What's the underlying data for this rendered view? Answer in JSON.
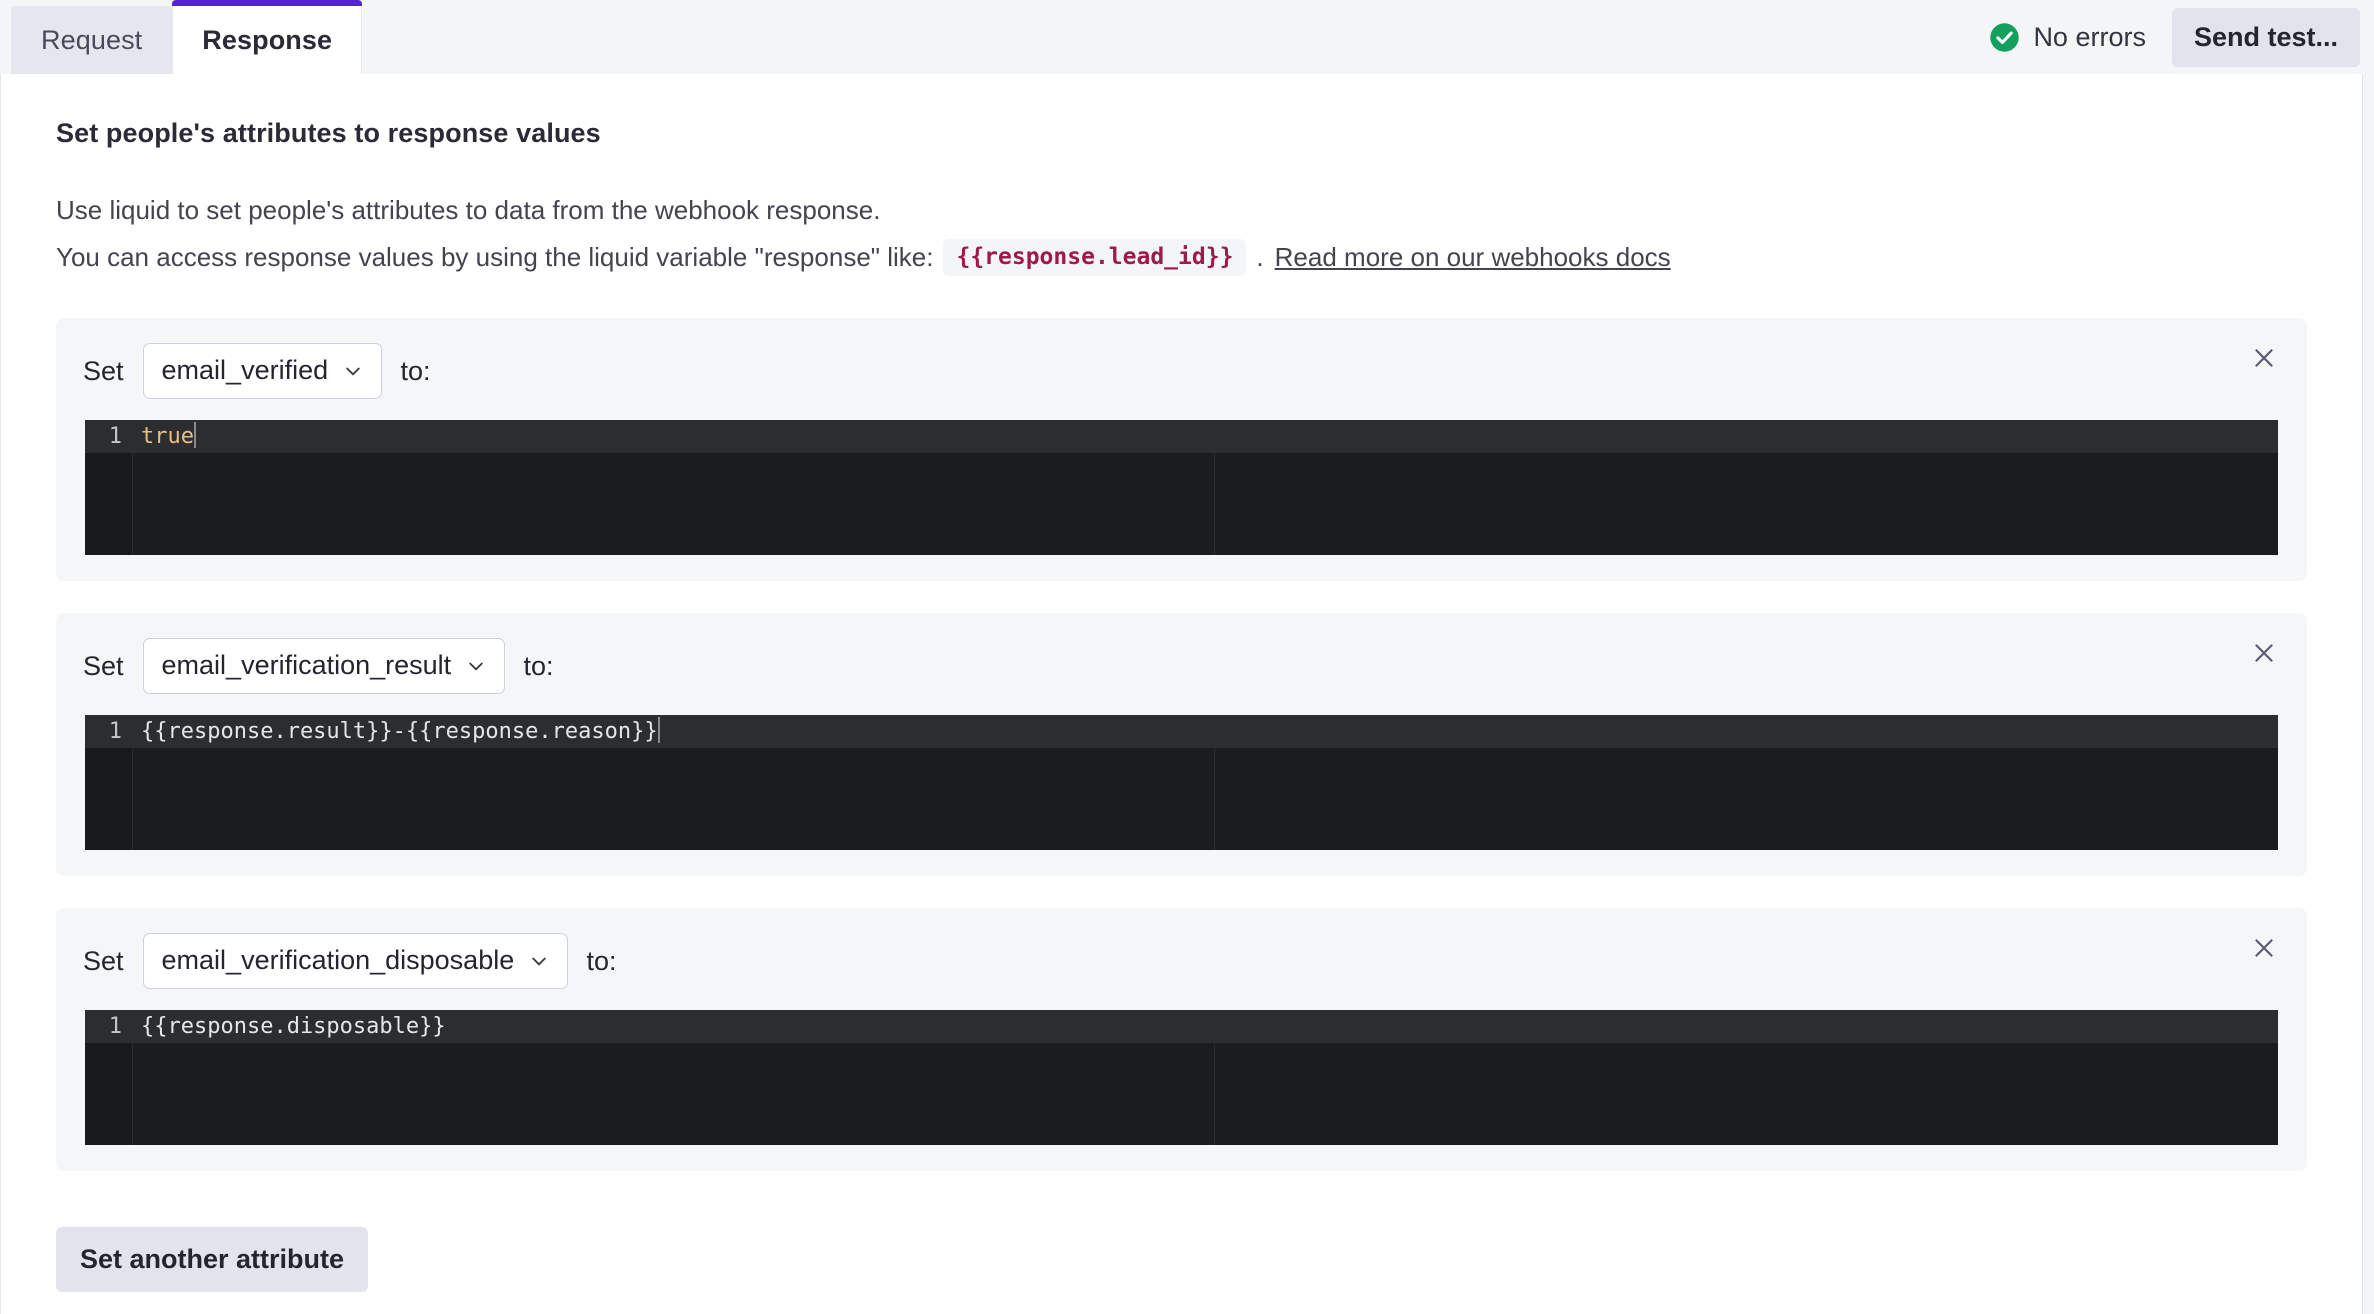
{
  "tabs": [
    {
      "label": "Request",
      "active": false
    },
    {
      "label": "Response",
      "active": true
    }
  ],
  "header": {
    "status_text": "No errors",
    "status_icon": "check-circle-icon",
    "status_color": "#12a05c",
    "send_test_label": "Send test...",
    "accent_color": "#5521d9"
  },
  "main": {
    "heading": "Set people's attributes to response values",
    "description_line1": "Use liquid to set people's attributes to data from the webhook response.",
    "description_line2_prefix": "You can access response values by using the liquid variable \"response\" like:",
    "code_example": "{{response.lead_id}}",
    "description_line2_suffix": ".",
    "docs_link_label": "Read more on our webhooks docs",
    "code_chip_color": "#9c1b4a"
  },
  "attributes": [
    {
      "set_label": "Set",
      "attribute_name": "email_verified",
      "to_label": "to:",
      "line_number": "1",
      "value": "true",
      "value_token_type": "boolean",
      "close_icon": "close-icon"
    },
    {
      "set_label": "Set",
      "attribute_name": "email_verification_result",
      "to_label": "to:",
      "line_number": "1",
      "value": "{{response.result}}-{{response.reason}}",
      "value_token_type": "text",
      "close_icon": "close-icon"
    },
    {
      "set_label": "Set",
      "attribute_name": "email_verification_disposable",
      "to_label": "to:",
      "line_number": "1",
      "value": "{{response.disposable}}",
      "value_token_type": "text",
      "close_icon": "close-icon"
    }
  ],
  "footer": {
    "set_another_label": "Set another attribute"
  }
}
